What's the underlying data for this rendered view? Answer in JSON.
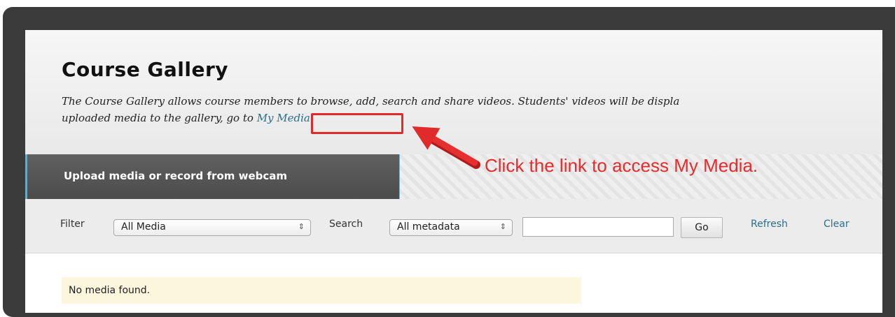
{
  "page": {
    "title": "Course Gallery",
    "description_line1": "The Course Gallery allows course members to browse, add, search and share videos. Students' videos will be displa",
    "description_line2_prefix": "uploaded media to the gallery, go to ",
    "description_link": "My Media",
    "description_line2_suffix": "."
  },
  "tabs": {
    "upload_label": "Upload media or record from webcam"
  },
  "annotation": {
    "text": "Click the link to access My Media.",
    "color": "#ea2a2a"
  },
  "filter": {
    "filter_label": "Filter",
    "filter_value": "All Media",
    "search_label": "Search",
    "search_scope_value": "All metadata",
    "search_query": "",
    "go_label": "Go",
    "refresh_label": "Refresh",
    "clear_label": "Clear"
  },
  "results": {
    "empty_message": "No media found."
  },
  "icons": {
    "select_arrows": "⇕"
  },
  "colors": {
    "link": "#2a6f8a",
    "tab_bg": "#555555",
    "empty_bg": "#fcf6dc"
  }
}
